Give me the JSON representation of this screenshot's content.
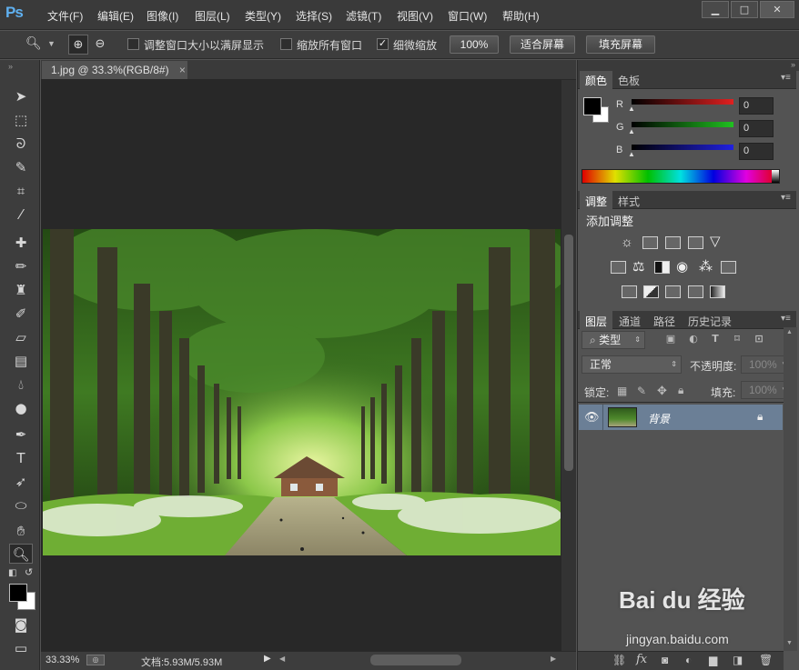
{
  "app": {
    "logo": "Ps"
  },
  "menu": [
    "文件(F)",
    "编辑(E)",
    "图像(I)",
    "图层(L)",
    "类型(Y)",
    "选择(S)",
    "滤镜(T)",
    "视图(V)",
    "窗口(W)",
    "帮助(H)"
  ],
  "window_controls": {
    "minimize": "▁",
    "maximize": "□",
    "close": "✕"
  },
  "options": {
    "resize_windows": {
      "label": "调整窗口大小以满屏显示",
      "checked": false
    },
    "zoom_all": {
      "label": "缩放所有窗口",
      "checked": false
    },
    "scrubby": {
      "label": "细微缩放",
      "checked": true
    },
    "btn_100": "100%",
    "btn_fit": "适合屏幕",
    "btn_fill": "填充屏幕"
  },
  "document": {
    "tab_title": "1.jpg @ 33.3%(RGB/8#)",
    "close": "×"
  },
  "status": {
    "zoom": "33.33%",
    "doc_size": "文档:5.93M/5.93M"
  },
  "color_panel": {
    "tabs": [
      "颜色",
      "色板"
    ],
    "sliders": [
      {
        "label": "R",
        "value": "0",
        "color": "#e02020"
      },
      {
        "label": "G",
        "value": "0",
        "color": "#20c020"
      },
      {
        "label": "B",
        "value": "0",
        "color": "#2020e0"
      }
    ]
  },
  "adjust_panel": {
    "tabs": [
      "调整",
      "样式"
    ],
    "title": "添加调整"
  },
  "layers_panel": {
    "tabs": [
      "图层",
      "通道",
      "路径",
      "历史记录"
    ],
    "filter_label": "类型",
    "blend_mode": "正常",
    "opacity_label": "不透明度:",
    "opacity_value": "100%",
    "lock_label": "锁定:",
    "fill_label": "填充:",
    "fill_value": "100%",
    "layer_name": "背景"
  },
  "watermark": {
    "brand": "Bai du 经验",
    "url": "jingyan.baidu.com"
  }
}
